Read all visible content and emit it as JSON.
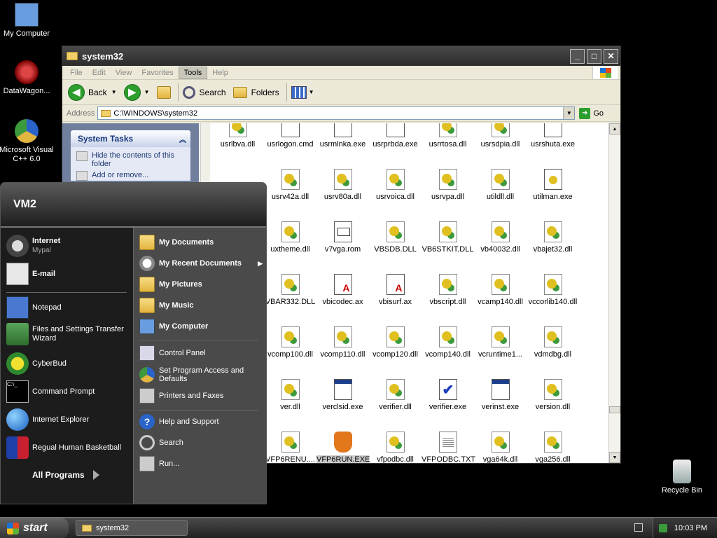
{
  "desktop": {
    "icons": [
      {
        "label": "My Computer"
      },
      {
        "label": "DataWagon..."
      },
      {
        "label": "Microsoft Visual C++ 6.0"
      },
      {
        "label": "Recycle Bin"
      }
    ]
  },
  "window": {
    "title": "system32",
    "menu": [
      "File",
      "Edit",
      "View",
      "Favorites",
      "Tools",
      "Help"
    ],
    "toolbar": {
      "back": "Back",
      "search": "Search",
      "folders": "Folders"
    },
    "address_label": "Address",
    "address_value": "C:\\WINDOWS\\system32",
    "go_label": "Go",
    "taskpane": {
      "title": "System Tasks",
      "items": [
        "Hide the contents of this folder",
        "Add or remove..."
      ]
    },
    "files": [
      [
        "usrlbva.dll",
        "usrlogon.cmd",
        "usrmlnka.exe",
        "usrprbda.exe",
        "usrrtosa.dll",
        "usrsdpia.dll",
        "usrshuta.exe"
      ],
      [
        "",
        "usrv42a.dll",
        "usrv80a.dll",
        "usrvoica.dll",
        "usrvpa.dll",
        "utildll.dll",
        "utilman.exe"
      ],
      [
        "",
        "uxtheme.dll",
        "v7vga.rom",
        "VBSDB.DLL",
        "VB6STKIT.DLL",
        "vb40032.dll",
        "vbajet32.dll"
      ],
      [
        "",
        "VBAR332.DLL",
        "vbicodec.ax",
        "vbisurf.ax",
        "vbscript.dll",
        "vcamp140.dll",
        "vccorlib140.dll"
      ],
      [
        "",
        "vcomp100.dll",
        "vcomp110.dll",
        "vcomp120.dll",
        "vcomp140.dll",
        "vcruntime1...",
        "vdmdbg.dll"
      ],
      [
        "",
        "ver.dll",
        "verclsid.exe",
        "verifier.dll",
        "verifier.exe",
        "verinst.exe",
        "version.dll"
      ],
      [
        "",
        "VFP6RENU....",
        "VFP6RUN.EXE",
        "vfpodbc.dll",
        "VFPODBC.TXT",
        "vga64k.dll",
        "vga256.dll"
      ]
    ]
  },
  "startmenu": {
    "user": "VM2",
    "pinned": [
      {
        "title": "Internet",
        "sub": "Mypal"
      },
      {
        "title": "E-mail",
        "sub": ""
      }
    ],
    "recent": [
      "Notepad",
      "Files and Settings Transfer Wizard",
      "CyberBud",
      "Command Prompt",
      "Internet Explorer",
      "Regual Human Basketball"
    ],
    "all_programs": "All Programs",
    "right": [
      "My Documents",
      "My Recent Documents",
      "My Pictures",
      "My Music",
      "My Computer",
      "Control Panel",
      "Set Program Access and Defaults",
      "Printers and Faxes",
      "Help and Support",
      "Search",
      "Run..."
    ]
  },
  "taskbar": {
    "start": "start",
    "task": "system32",
    "clock": "10:03 PM"
  }
}
